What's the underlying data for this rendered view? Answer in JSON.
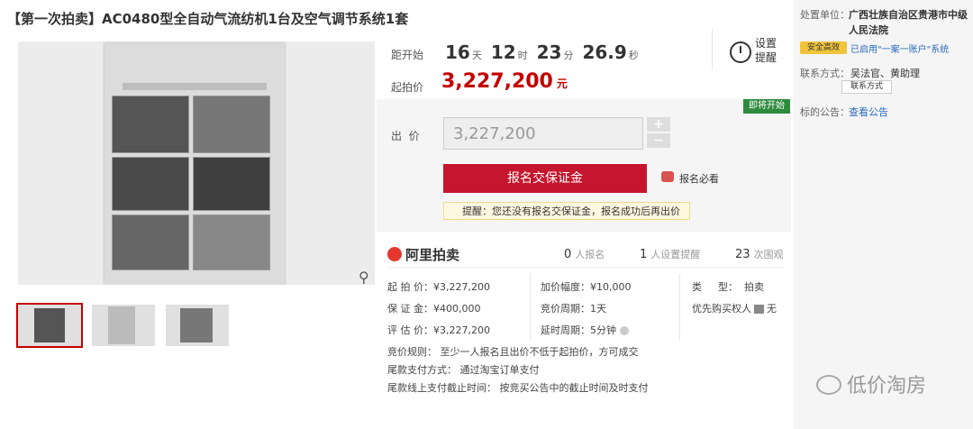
{
  "title": "【第一次拍卖】AC0480型全自动气流纺机1台及空气调节系统1套",
  "countdown": {
    "label": "距开始",
    "days": "16",
    "days_unit": "天",
    "hours": "12",
    "hours_unit": "时",
    "minutes": "23",
    "minutes_unit": "分",
    "seconds": "26.9",
    "seconds_unit": "秒",
    "remind_label": "设置提醒"
  },
  "start_price": {
    "label": "起拍价",
    "value": "3,227,200",
    "unit": "元"
  },
  "bid": {
    "status_badge": "即将开始",
    "label": "出  价",
    "input_value": "3,227,200",
    "plus": "+",
    "minus": "−",
    "signup_button": "报名交保证金",
    "must_see": "报名必看",
    "tip": "提醒：您还没有报名交保证金，报名成功后再出价"
  },
  "stats": {
    "logo": "阿里拍卖",
    "signup_count": "0",
    "signup_label": "人报名",
    "remind_count": "1",
    "remind_label": "人设置提醒",
    "view_count": "23",
    "view_label": "次围观"
  },
  "details": {
    "start_price": "起 拍 价：¥3,227,200",
    "deposit": "保 证 金：¥400,000",
    "appraisal": "评 估 价：¥3,227,200",
    "increment": "加价幅度：¥10,000",
    "period": "竞价周期：1天",
    "delay": "延时周期：5分钟",
    "type": "类　  型：  拍卖",
    "priority": "优先购买权人",
    "priority_value": "无",
    "rule": "竞价规则：  至少一人报名且出价不低于起拍价，方可成交",
    "payment": "尾款支付方式：  通过淘宝订单支付",
    "deadline": "尾款线上支付截止时间：  按竞买公告中的截止时间及时支付"
  },
  "sidebar": {
    "org_label": "处置单位：",
    "org_value": "广西壮族自治区贵港市中级人民法院",
    "safe_badge": "安全高效",
    "account_link": "已启用\"一案一账户\"系统",
    "contact_label": "联系方式：",
    "contact_value": "吴法官、黄助理",
    "contact_button": "联系方式",
    "notice_label": "标的公告：",
    "notice_link": "查看公告"
  },
  "watermark": "低价淘房"
}
